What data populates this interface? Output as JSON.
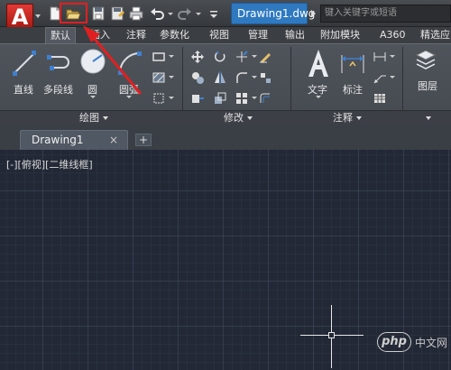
{
  "app": {
    "logo_letter": "A",
    "brand_color": "#c8231b"
  },
  "title_bar": {
    "file_tab": "Drawing1.dwg",
    "search_placeholder": "键入关键字或短语"
  },
  "quick_access": [
    {
      "name": "new-icon"
    },
    {
      "name": "open-icon"
    },
    {
      "name": "save-icon"
    },
    {
      "name": "save-as-icon"
    },
    {
      "name": "print-icon"
    },
    {
      "name": "undo-icon"
    },
    {
      "name": "redo-icon"
    },
    {
      "name": "customize-icon"
    }
  ],
  "ribbon_tabs": [
    "默认",
    "插入",
    "注释",
    "参数化",
    "视图",
    "管理",
    "输出",
    "附加模块",
    "A360",
    "精选应"
  ],
  "active_tab": "默认",
  "ribbon": {
    "draw_tools": {
      "line": "直线",
      "polyline": "多段线",
      "circle": "圆",
      "arc": "圆弧"
    },
    "annotation_tools": {
      "text": "文字",
      "dimension": "标注"
    },
    "layers_tool": "图层",
    "panels": {
      "draw": "绘图",
      "modify": "修改",
      "annotation": "注释"
    }
  },
  "document_tab": {
    "title": "Drawing1",
    "close": "×",
    "new_tab": "+"
  },
  "viewport": {
    "label": "[-][俯视][二维线框]"
  },
  "watermark": {
    "logo": "php",
    "text": "中文网"
  },
  "colors": {
    "highlight": "#e02020",
    "file_tab": "#2f79c0",
    "canvas": "#222835"
  }
}
